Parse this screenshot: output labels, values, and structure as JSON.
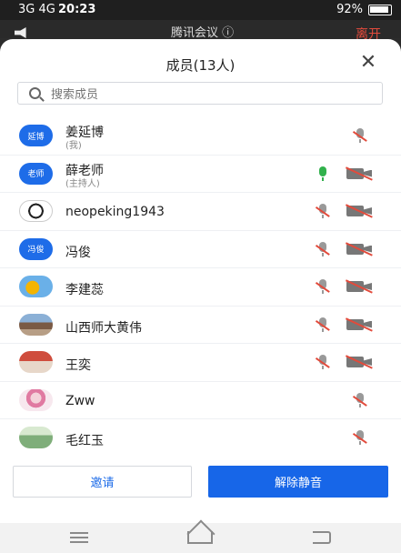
{
  "status_bar": {
    "signal": "3G 4G",
    "time": "20:23",
    "battery": "92%"
  },
  "app_header": {
    "title": "腾讯会议 ⓘ",
    "end": "离开"
  },
  "sheet": {
    "title": "成员(13人)",
    "search_placeholder": "搜索成员"
  },
  "members": [
    {
      "avatar_text": "延博",
      "name": "姜延博",
      "sub": "(我)",
      "mic": "muted",
      "cam": false
    },
    {
      "avatar_text": "老师",
      "name": "薛老师",
      "sub": "(主持人)",
      "mic": "active",
      "cam": true
    },
    {
      "avatar_text": "",
      "name": "neopeking1943",
      "sub": "",
      "mic": "muted",
      "cam": true
    },
    {
      "avatar_text": "冯俊",
      "name": "冯俊",
      "sub": "",
      "mic": "muted",
      "cam": true
    },
    {
      "avatar_text": "",
      "name": "李建蕊",
      "sub": "",
      "mic": "muted",
      "cam": true
    },
    {
      "avatar_text": "",
      "name": "山西师大黄伟",
      "sub": "",
      "mic": "muted",
      "cam": true
    },
    {
      "avatar_text": "",
      "name": "王奕",
      "sub": "",
      "mic": "muted",
      "cam": true
    },
    {
      "avatar_text": "",
      "name": "Zww",
      "sub": "",
      "mic": "muted",
      "cam": false
    },
    {
      "avatar_text": "",
      "name": "毛红玉",
      "sub": "",
      "mic": "muted",
      "cam": false
    }
  ],
  "buttons": {
    "invite": "邀请",
    "unmute": "解除静音"
  },
  "colors": {
    "accent": "#1766e8",
    "danger": "#e24b3c",
    "mic_active": "#31b14c"
  }
}
